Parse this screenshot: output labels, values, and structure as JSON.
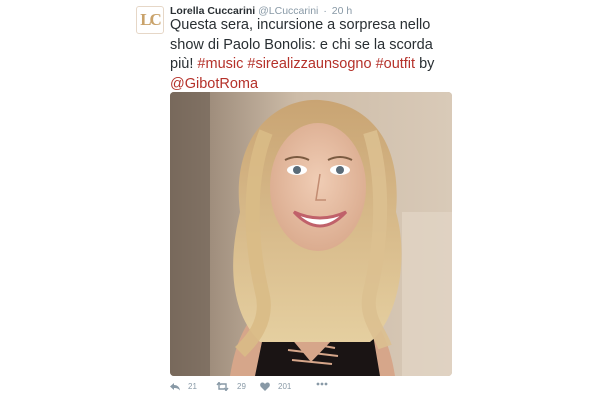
{
  "tweet": {
    "avatar_initials": "LC",
    "author_name": "Lorella Cuccarini",
    "author_handle": "@LCuccarini",
    "separator": "·",
    "timestamp": "20 h",
    "text_parts": [
      "Questa sera, incursione a sorpresa nello show di Paolo Bonolis: e chi se la scorda più! ",
      "#music",
      " ",
      "#sirealizzaunsogno",
      " ",
      "#outfit",
      " by ",
      "@GibotRoma"
    ],
    "photo_icon": "selfie-photo",
    "actions": {
      "reply_icon": "reply-icon",
      "reply_count": "21",
      "retweet_icon": "retweet-icon",
      "retweet_count": "29",
      "like_icon": "heart-icon",
      "like_count": "201",
      "more_icon": "more-icon"
    },
    "colors": {
      "hashtag": "#b5312a",
      "meta": "#8899a6",
      "text": "#292f33",
      "avatar": "#c9a26a"
    }
  }
}
